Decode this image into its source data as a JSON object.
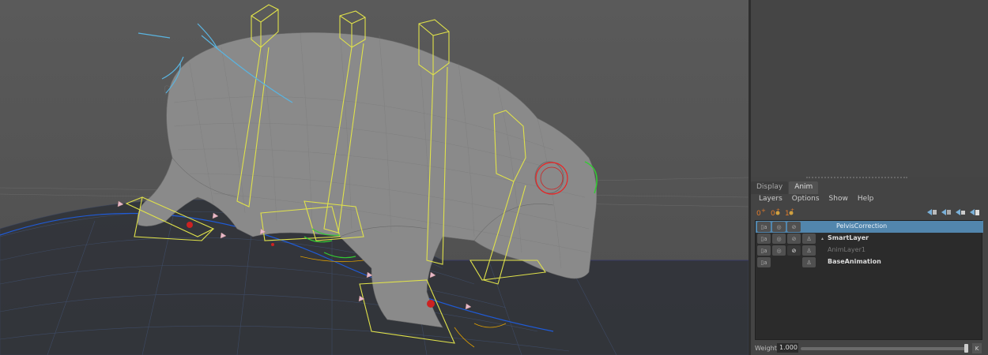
{
  "viewport": {
    "name": "3D Viewport"
  },
  "layer_editor": {
    "tabs": [
      {
        "label": "Display",
        "active": false
      },
      {
        "label": "Anim",
        "active": true
      }
    ],
    "menu": [
      "Layers",
      "Options",
      "Show",
      "Help"
    ],
    "toolbar_icons": [
      "new-empty-layer-icon",
      "new-layer-from-selected-icon",
      "new-override-layer-icon",
      "move-layer-up-icon",
      "move-layer-down-icon",
      "select-objects-icon",
      "zoom-layer-icon"
    ],
    "layers": [
      {
        "name": "PelvisCorrection",
        "selected": true,
        "style": "normal"
      },
      {
        "name": "SmartLayer",
        "selected": false,
        "style": "bold",
        "collapsible": true
      },
      {
        "name": "AnimLayer1",
        "selected": false,
        "style": "dim"
      },
      {
        "name": "BaseAnimation",
        "selected": false,
        "style": "bold"
      }
    ],
    "layer_buttons": {
      "lock": "lock-icon",
      "solo": "solo-icon",
      "mute": "mute-icon",
      "ghost": "ghost-icon"
    },
    "weight": {
      "label": "Weight",
      "value": "1.000",
      "fraction": 1.0,
      "key_label": "K"
    }
  },
  "colors": {
    "selection": "#5286ad",
    "rig_yellow": "#e0e24a",
    "controls_blue": "#5ab4e0"
  }
}
